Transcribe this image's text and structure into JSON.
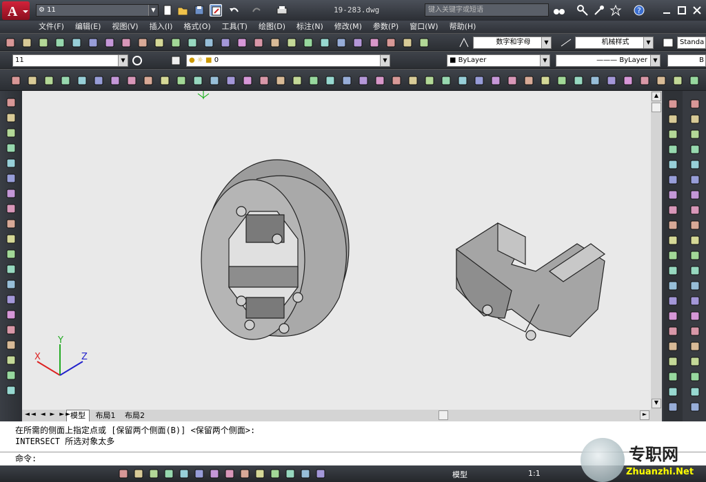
{
  "titlebar": {
    "workspace": "11",
    "filename": "19-283.dwg",
    "search_placeholder": "键入关键字或短语"
  },
  "menu": [
    "文件(F)",
    "编辑(E)",
    "视图(V)",
    "插入(I)",
    "格式(O)",
    "工具(T)",
    "绘图(D)",
    "标注(N)",
    "修改(M)",
    "参数(P)",
    "窗口(W)",
    "帮助(H)"
  ],
  "toolbar2": {
    "text_style": "数字和字母",
    "dim_style": "机械样式",
    "table_style": "Standa"
  },
  "toolbar3": {
    "workspace_combo": "11",
    "layer_combo": "0",
    "color_combo": "ByLayer",
    "linetype_combo": "ByLayer",
    "lineweight_combo": "B"
  },
  "tabs": [
    "模型",
    "布局1",
    "布局2"
  ],
  "ucs": {
    "x": "X",
    "y": "Y",
    "z": "Z"
  },
  "command": {
    "line1": "在所需的侧面上指定点或 [保留两个侧面(B)] <保留两个侧面>:",
    "line2": "INTERSECT 所选对象太多",
    "prompt": "命令:"
  },
  "status": {
    "model_label": "模型",
    "scale": "1:1",
    "watermark_cn": "专职网",
    "watermark_url": "Zhuanzhi.Net"
  },
  "colors": {
    "accent": "#c8102e",
    "canvas": "#e9e9e9",
    "part": "#a6a6a6"
  }
}
